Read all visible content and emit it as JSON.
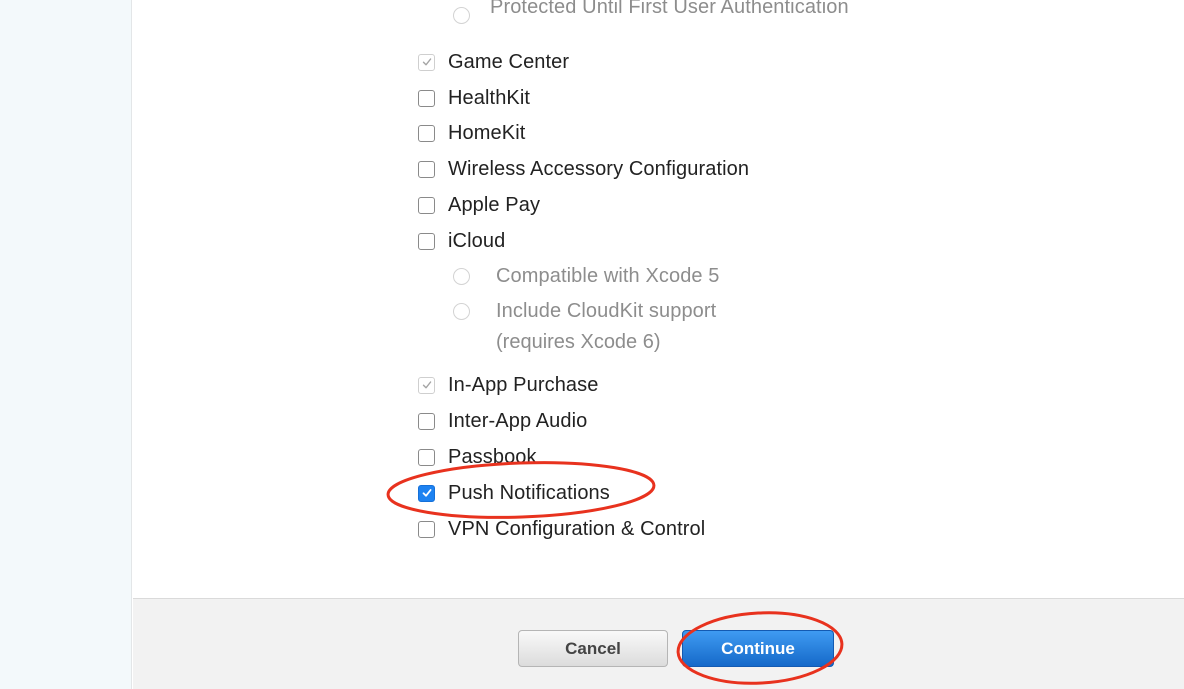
{
  "colors": {
    "annotation_red": "#e8321e",
    "checkbox_blue": "#1d82f1",
    "continue_button": "#1d78de",
    "footer_bg": "#f2f2f2",
    "gutter_bg": "#f3f9fb"
  },
  "capabilities": {
    "top_partial": "Protected Until First User Authentication",
    "items": [
      {
        "label": "Game Center",
        "state": "checked-disabled"
      },
      {
        "label": "HealthKit",
        "state": "unchecked"
      },
      {
        "label": "HomeKit",
        "state": "unchecked"
      },
      {
        "label": "Wireless Accessory Configuration",
        "state": "unchecked"
      },
      {
        "label": "Apple Pay",
        "state": "unchecked"
      },
      {
        "label": "iCloud",
        "state": "unchecked"
      },
      {
        "label": "In-App Purchase",
        "state": "checked-disabled"
      },
      {
        "label": "Inter-App Audio",
        "state": "unchecked"
      },
      {
        "label": "Passbook",
        "state": "unchecked"
      },
      {
        "label": "Push Notifications",
        "state": "checked"
      },
      {
        "label": "VPN Configuration & Control",
        "state": "unchecked"
      }
    ],
    "icloud_options": [
      {
        "label": "Compatible with Xcode 5"
      },
      {
        "label_line1": "Include CloudKit support",
        "label_line2": "(requires Xcode 6)"
      }
    ]
  },
  "footer": {
    "cancel_label": "Cancel",
    "continue_label": "Continue"
  },
  "icons": {
    "check": "checkmark-icon",
    "radio": "radio-circle-icon",
    "annotation": "red-ellipse-highlight"
  }
}
